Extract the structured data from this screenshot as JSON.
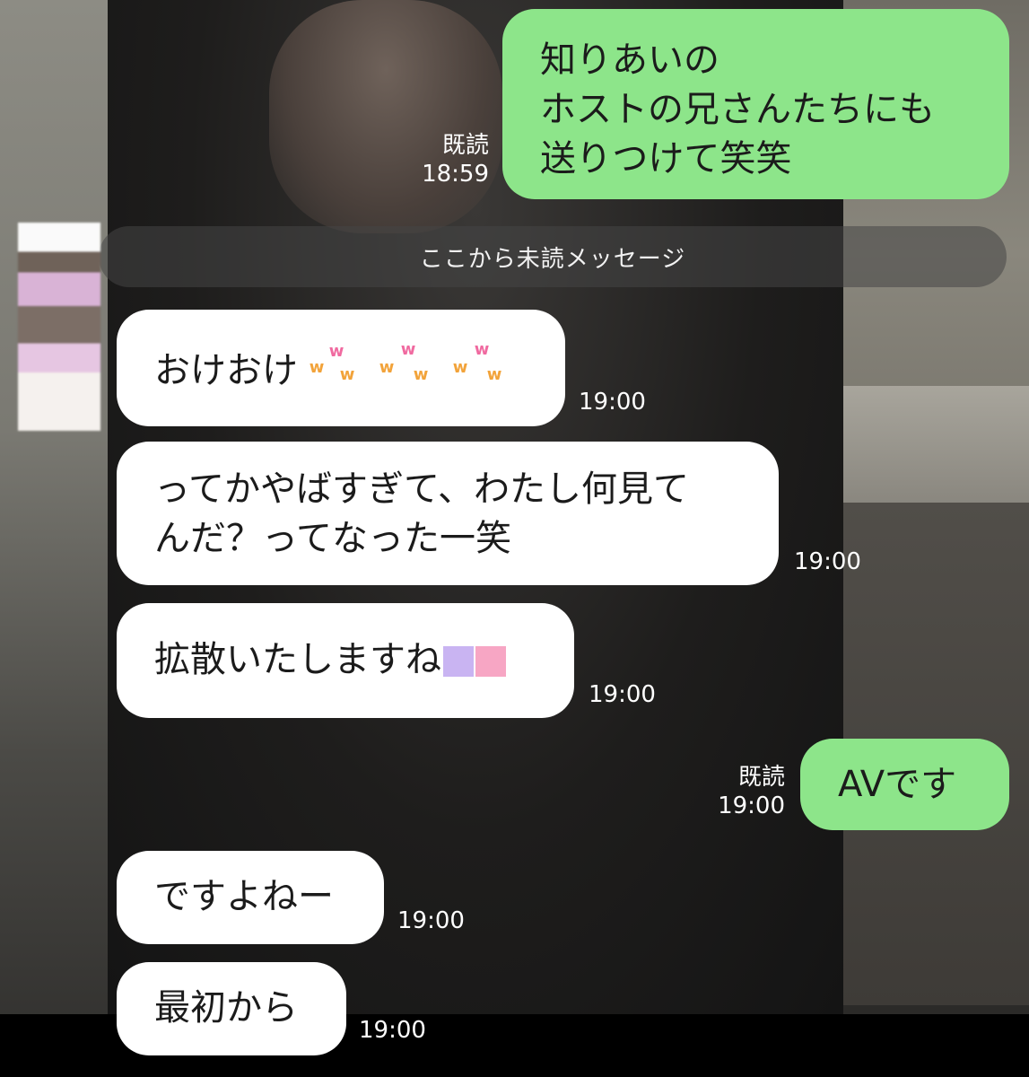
{
  "chat": {
    "unread_divider": "ここから未読メッセージ",
    "messages": [
      {
        "id": "m1",
        "side": "out",
        "lines": [
          "知りあいの",
          "ホストの兄さんたちにも",
          "送りつけて笑笑"
        ],
        "read": "既読",
        "time": "18:59"
      },
      {
        "id": "m2",
        "side": "in",
        "text": "おけおけ",
        "emoji": "www-sticker",
        "time": "19:00"
      },
      {
        "id": "m3",
        "side": "in",
        "lines": [
          "ってかやばすぎて、わたし何見て",
          "んだ？ってなった一笑"
        ],
        "time": "19:00"
      },
      {
        "id": "m4",
        "side": "in",
        "text": "拡散いたしますね",
        "emoji": "hearts",
        "time": "19:00"
      },
      {
        "id": "m5",
        "side": "out",
        "text": "AVです",
        "read": "既読",
        "time": "19:00"
      },
      {
        "id": "m6",
        "side": "in",
        "text": "ですよねー",
        "time": "19:00"
      },
      {
        "id": "m7",
        "side": "in",
        "text": "最初から",
        "time": "19:00"
      }
    ],
    "w_glyphs": [
      "w",
      "w",
      "w",
      "w",
      "w",
      "w",
      "w",
      "w",
      "w"
    ]
  },
  "colors": {
    "outgoing_bubble": "#8de58a",
    "incoming_bubble": "#ffffff"
  }
}
